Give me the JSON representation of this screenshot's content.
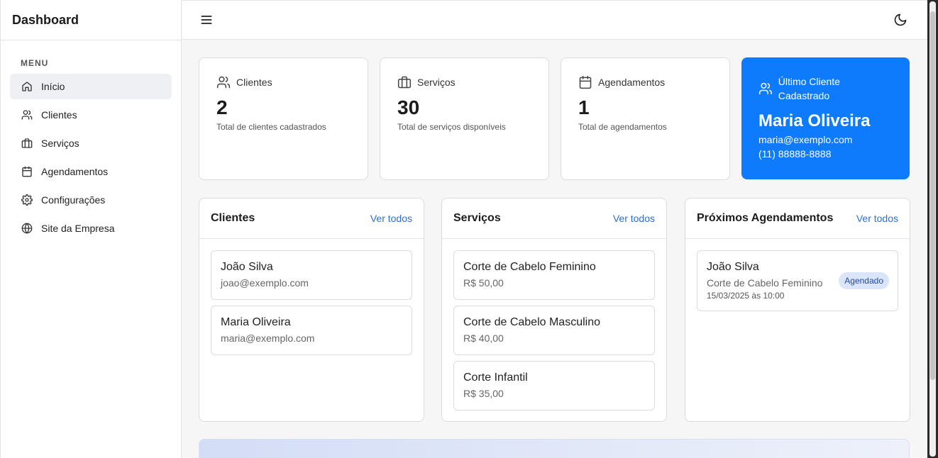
{
  "app": {
    "title": "Dashboard"
  },
  "sidebar": {
    "menu_label": "MENU",
    "items": [
      {
        "label": "Início",
        "icon": "home-icon",
        "active": true
      },
      {
        "label": "Clientes",
        "icon": "users-icon"
      },
      {
        "label": "Serviços",
        "icon": "briefcase-icon"
      },
      {
        "label": "Agendamentos",
        "icon": "calendar-icon"
      },
      {
        "label": "Configurações",
        "icon": "gear-icon"
      },
      {
        "label": "Site da Empresa",
        "icon": "globe-icon"
      }
    ]
  },
  "topbar": {
    "menu_icon": "hamburger-icon",
    "theme_icon": "moon-icon"
  },
  "stats": [
    {
      "label": "Clientes",
      "value": "2",
      "sub": "Total de clientes cadastrados",
      "icon": "users-icon"
    },
    {
      "label": "Serviços",
      "value": "30",
      "sub": "Total de serviços disponíveis",
      "icon": "briefcase-icon"
    },
    {
      "label": "Agendamentos",
      "value": "1",
      "sub": "Total de agendamentos",
      "icon": "calendar-icon"
    }
  ],
  "last_client": {
    "label": "Último Cliente Cadastrado",
    "name": "Maria Oliveira",
    "email": "maria@exemplo.com",
    "phone": "(11) 88888-8888",
    "color": "#0d7bfb"
  },
  "panels": {
    "clients": {
      "title": "Clientes",
      "link": "Ver todos",
      "items": [
        {
          "name": "João Silva",
          "email": "joao@exemplo.com"
        },
        {
          "name": "Maria Oliveira",
          "email": "maria@exemplo.com"
        }
      ]
    },
    "services": {
      "title": "Serviços",
      "link": "Ver todos",
      "items": [
        {
          "name": "Corte de Cabelo Feminino",
          "price": "R$ 50,00"
        },
        {
          "name": "Corte de Cabelo Masculino",
          "price": "R$ 40,00"
        },
        {
          "name": "Corte Infantil",
          "price": "R$ 35,00"
        }
      ]
    },
    "appointments": {
      "title": "Próximos Agendamentos",
      "link": "Ver todos",
      "items": [
        {
          "client": "João Silva",
          "service": "Corte de Cabelo Feminino",
          "datetime": "15/03/2025 às 10:00",
          "status": "Agendado"
        }
      ]
    }
  },
  "colors": {
    "accent": "#0d7bfb",
    "link": "#2b6fd6",
    "badge_bg": "#dbe5f9"
  }
}
